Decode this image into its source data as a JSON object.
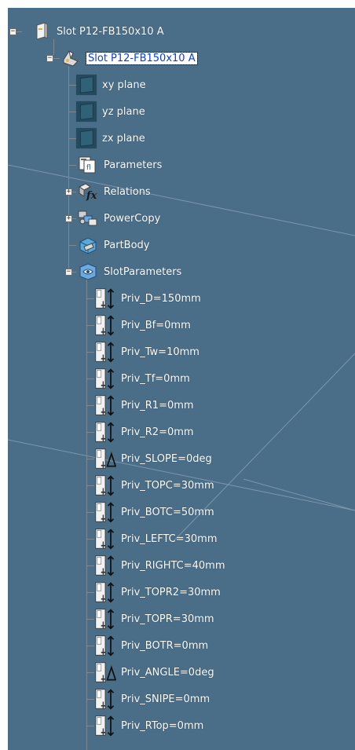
{
  "tree": {
    "root": {
      "label": "Slot P12-FB150x10 A",
      "icon": "product-icon",
      "expanded": true
    },
    "part": {
      "label": "Slot P12-FB150x10 A",
      "icon": "part-icon",
      "expanded": true,
      "selected": true
    },
    "planes": [
      {
        "label": "xy plane",
        "icon": "plane-icon"
      },
      {
        "label": "yz plane",
        "icon": "plane-icon"
      },
      {
        "label": "zx plane",
        "icon": "plane-icon"
      }
    ],
    "nodes": [
      {
        "label": "Parameters",
        "icon": "parameters-icon",
        "expander": "none"
      },
      {
        "label": "Relations",
        "icon": "relations-icon",
        "expander": "collapsed"
      },
      {
        "label": "PowerCopy",
        "icon": "powercopy-icon",
        "expander": "collapsed"
      },
      {
        "label": "PartBody",
        "icon": "partbody-icon",
        "expander": "none"
      },
      {
        "label": "SlotParameters",
        "icon": "geometrical-set-icon",
        "expander": "expanded"
      }
    ],
    "parameters": [
      {
        "label": "Priv_D=150mm",
        "icon": "length-parameter-icon"
      },
      {
        "label": "Priv_Bf=0mm",
        "icon": "length-parameter-icon"
      },
      {
        "label": "Priv_Tw=10mm",
        "icon": "length-parameter-icon"
      },
      {
        "label": "Priv_Tf=0mm",
        "icon": "length-parameter-icon"
      },
      {
        "label": "Priv_R1=0mm",
        "icon": "length-parameter-icon"
      },
      {
        "label": "Priv_R2=0mm",
        "icon": "length-parameter-icon"
      },
      {
        "label": "Priv_SLOPE=0deg",
        "icon": "angle-parameter-icon"
      },
      {
        "label": "Priv_TOPC=30mm",
        "icon": "length-parameter-icon"
      },
      {
        "label": "Priv_BOTC=50mm",
        "icon": "length-parameter-icon"
      },
      {
        "label": "Priv_LEFTC=30mm",
        "icon": "length-parameter-icon"
      },
      {
        "label": "Priv_RIGHTC=40mm",
        "icon": "length-parameter-icon"
      },
      {
        "label": "Priv_TOPR2=30mm",
        "icon": "length-parameter-icon"
      },
      {
        "label": "Priv_TOPR=30mm",
        "icon": "length-parameter-icon"
      },
      {
        "label": "Priv_BOTR=0mm",
        "icon": "length-parameter-icon"
      },
      {
        "label": "Priv_ANGLE=0deg",
        "icon": "angle-parameter-icon"
      },
      {
        "label": "Priv_SNIPE=0mm",
        "icon": "length-parameter-icon"
      },
      {
        "label": "Priv_RTop=0mm",
        "icon": "length-parameter-icon"
      }
    ]
  },
  "colors": {
    "background": "#4a6d88",
    "selection_text": "#0b3fd1",
    "tree_line": "#7d8892"
  }
}
